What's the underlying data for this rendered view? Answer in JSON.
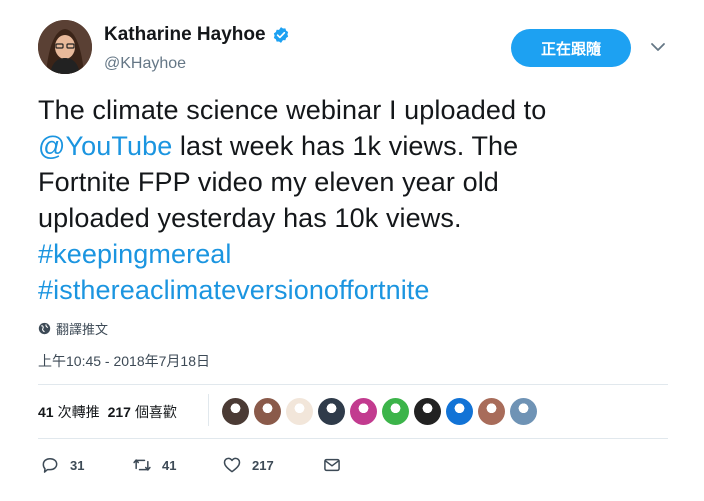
{
  "colors": {
    "accent": "#1da1f2",
    "link": "#1b95e0",
    "text": "#14171a",
    "muted": "#657786",
    "divider": "#e1e8ed"
  },
  "author": {
    "display_name": "Katharine Hayhoe",
    "handle": "@KHayhoe",
    "verified": true
  },
  "follow_button": {
    "label": "正在跟隨"
  },
  "tweet": {
    "lines": [
      [
        {
          "text": "The climate science webinar I uploaded to",
          "link": false
        }
      ],
      [
        {
          "text": "@YouTube",
          "link": true
        },
        {
          "text": " last week has 1k views. The",
          "link": false
        }
      ],
      [
        {
          "text": "Fortnite FPP video my eleven year old",
          "link": false
        }
      ],
      [
        {
          "text": "uploaded yesterday has 10k views.",
          "link": false
        }
      ],
      [
        {
          "text": "#keepingmereal",
          "link": true
        }
      ],
      [
        {
          "text": "#isthereaclimateversionoffortnite",
          "link": true
        }
      ]
    ]
  },
  "translate_label": "翻譯推文",
  "timestamp": "上午10:45 - 2018年7月18日",
  "stats": {
    "retweets_count": "41",
    "retweets_label": "次轉推",
    "likes_count": "217",
    "likes_label": "個喜歡"
  },
  "likers": [
    {
      "icon": "liker-avatar",
      "color": "#4b3b35"
    },
    {
      "icon": "liker-avatar",
      "color": "#8a5a4a"
    },
    {
      "icon": "liker-avatar",
      "color": "#f2e6da"
    },
    {
      "icon": "liker-avatar",
      "color": "#2f3b4a"
    },
    {
      "icon": "liker-avatar",
      "color": "#c23b8f"
    },
    {
      "icon": "liker-avatar",
      "color": "#3cb44a"
    },
    {
      "icon": "liker-avatar",
      "color": "#222222"
    },
    {
      "icon": "liker-avatar",
      "color": "#1273d6"
    },
    {
      "icon": "liker-avatar",
      "color": "#a86c5a"
    },
    {
      "icon": "liker-avatar",
      "color": "#6f93b5"
    }
  ],
  "actions": {
    "reply_count": "31",
    "retweet_count": "41",
    "like_count": "217"
  }
}
